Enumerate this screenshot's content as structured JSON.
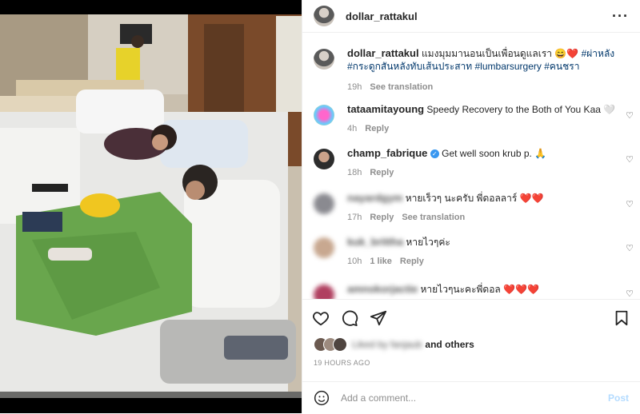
{
  "post": {
    "username": "dollar_rattakul",
    "caption_user": "dollar_rattakul",
    "caption_text": "แมงมุมมานอนเป็นเพื่อนดูแลเรา 😄❤️",
    "caption_tags": "#ผ่าหลัง #กระดูกสันหลังทับเส้นประสาท #lumbarsurgery #คนชรา",
    "caption_time": "19h",
    "see_translation": "See translation",
    "more_icon": "more-options-icon"
  },
  "comments": [
    {
      "user": "tataamitayoung",
      "text": "Speedy Recovery to the Both of You Kaa 🤍",
      "time": "4h",
      "reply": "Reply",
      "verified": false
    },
    {
      "user": "champ_fabrique",
      "text": "Get well soon krub p. 🙏",
      "time": "18h",
      "reply": "Reply",
      "verified": true
    },
    {
      "user": "nayardgym",
      "text": "หายเร็วๆ นะครับ พี่ดอลลาร์ ❤️❤️",
      "time": "17h",
      "reply": "Reply",
      "see_translation": "See translation",
      "verified": false
    },
    {
      "user": "kuk_brittha",
      "text": "หายไวๆค่ะ",
      "time": "10h",
      "likes": "1 like",
      "reply": "Reply",
      "verified": false
    },
    {
      "user": "amnokorjactie",
      "text": "หายไวๆนะคะพี่ดอล ❤️❤️❤️",
      "verified": false
    }
  ],
  "likes": {
    "names": "Liked by fanjaub",
    "and_others": "and others"
  },
  "timestamp": "19 HOURS AGO",
  "add_comment": {
    "placeholder": "Add a comment...",
    "post_label": "Post"
  },
  "colors": {
    "link": "#00376b",
    "muted": "#8e8e8e",
    "post_disabled": "#b3dbff",
    "heart": "#ed4956"
  }
}
